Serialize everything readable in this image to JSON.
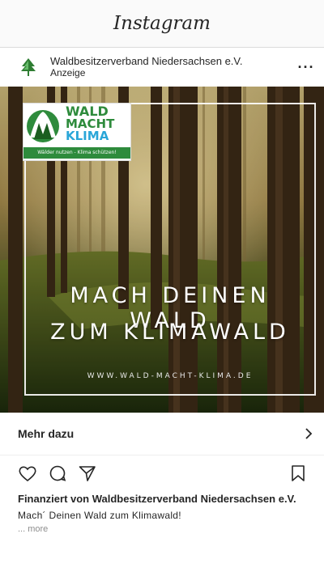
{
  "app": {
    "brand": "Instagram"
  },
  "post": {
    "account_name": "Waldbesitzerverband Niedersachsen e.V.",
    "sponsored_label": "Anzeige",
    "menu_icon": "more-dots-icon"
  },
  "ad": {
    "logo_line1": "WALD",
    "logo_line2": "MACHT",
    "logo_line3": "KLIMA",
    "logo_tagline": "Wälder nutzen - Klima schützen!",
    "headline_line1": "MACH DEINEN WALD",
    "headline_line2": "ZUM KLIMAWALD",
    "url": "WWW.WALD-MACHT-KLIMA.DE"
  },
  "cta": {
    "label": "Mehr dazu",
    "icon": "chevron-right-icon"
  },
  "actions": {
    "icons": [
      "heart-icon",
      "comment-icon",
      "share-icon",
      "bookmark-icon"
    ]
  },
  "caption": {
    "sponsor": "Finanziert von Waldbesitzerverband Niedersachsen e.V.",
    "text": "Mach´ Deinen Wald zum Klimawald!",
    "more": "... more"
  }
}
